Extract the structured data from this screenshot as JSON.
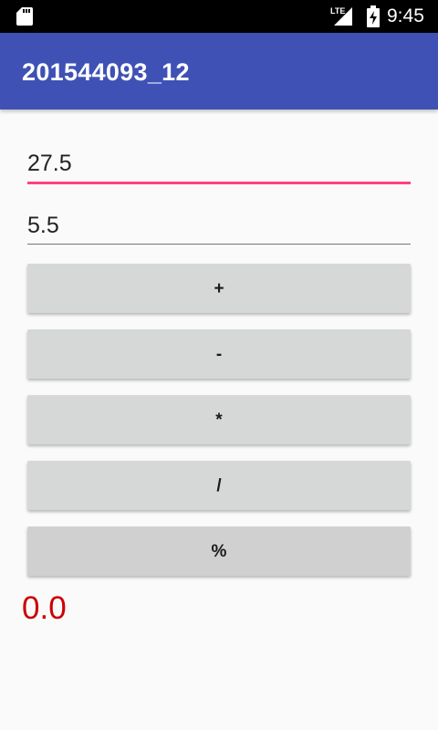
{
  "status_bar": {
    "time": "9:45",
    "network_label": "LTE",
    "icons": [
      "sd-card-icon",
      "lte-signal-icon",
      "battery-charging-icon"
    ]
  },
  "app_bar": {
    "title": "201544093_12",
    "color": "#3f51b5"
  },
  "inputs": {
    "first_value": "27.5",
    "second_value": "5.5",
    "focused_underline_color": "#ff4081"
  },
  "buttons": {
    "add": "+",
    "subtract": "-",
    "multiply": "*",
    "divide": "/",
    "modulo": "%"
  },
  "result": {
    "value": "0.0",
    "color": "#cc0000"
  }
}
